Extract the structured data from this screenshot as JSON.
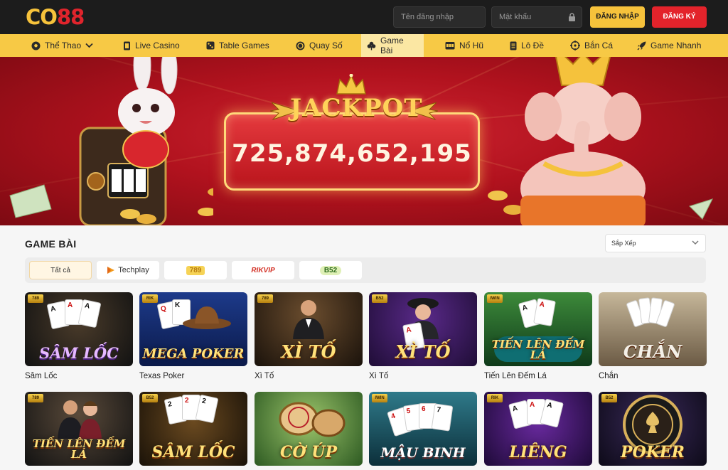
{
  "header": {
    "logo": {
      "part1": "CO",
      "part2": "88"
    },
    "username_placeholder": "Tên đăng nhập",
    "password_placeholder": "Mật khẩu",
    "login_label": "ĐĂNG NHẬP",
    "register_label": "ĐĂNG KÝ"
  },
  "nav": {
    "items": [
      {
        "label": "Thể Thao",
        "icon": "soccer-ball-icon",
        "dropdown": true
      },
      {
        "label": "Live Casino",
        "icon": "cards-icon"
      },
      {
        "label": "Table Games",
        "icon": "dice-icon"
      },
      {
        "label": "Quay Số",
        "icon": "coin-icon"
      },
      {
        "label": "Game Bài",
        "icon": "club-suit-icon",
        "active": true
      },
      {
        "label": "Nổ Hũ",
        "icon": "slot-machine-icon"
      },
      {
        "label": "Lô Đề",
        "icon": "ticket-icon"
      },
      {
        "label": "Bắn Cá",
        "icon": "target-icon"
      },
      {
        "label": "Game Nhanh",
        "icon": "rocket-icon"
      }
    ]
  },
  "banner": {
    "title": "JACKPOT",
    "amount": "725,874,652,195"
  },
  "section": {
    "title": "GAME BÀI",
    "sort_label": "Sắp Xếp",
    "filters": [
      {
        "label": "Tất cả",
        "active": true
      },
      {
        "label": "Techplay"
      },
      {
        "label": "789"
      },
      {
        "label": "RIKVIP"
      },
      {
        "label": "B52"
      }
    ]
  },
  "games": [
    {
      "name": "Sâm Lốc",
      "art": "SÂM LỐC",
      "tag": "789"
    },
    {
      "name": "Texas Poker",
      "art": "MEGA POKER",
      "tag": "RIK"
    },
    {
      "name": "Xì Tố",
      "art": "XÌ TỐ",
      "tag": "789"
    },
    {
      "name": "Xì Tố",
      "art": "XÌ TỐ",
      "tag": "B52"
    },
    {
      "name": "Tiến Lên Đếm Lá",
      "art": "TIẾN LÊN ĐẾM LÁ",
      "tag": "IWIN"
    },
    {
      "name": "Chắn",
      "art": "CHẮN",
      "tag": ""
    },
    {
      "name": "",
      "art": "TIẾN LÊN ĐẾM LÁ",
      "tag": "789"
    },
    {
      "name": "",
      "art": "SÂM LỐC",
      "tag": "B52"
    },
    {
      "name": "",
      "art": "CỜ ÚP",
      "tag": ""
    },
    {
      "name": "",
      "art": "MẬU BINH",
      "tag": "IWIN"
    },
    {
      "name": "",
      "art": "LIÊNG",
      "tag": "RIK"
    },
    {
      "name": "",
      "art": "POKER",
      "tag": "B52"
    }
  ],
  "colors": {
    "header_bg": "#1c1c1c",
    "nav_bg": "#f7c945",
    "login_btn": "#f6c23b",
    "register_btn": "#e3232b",
    "banner_red": "#b1121e"
  }
}
